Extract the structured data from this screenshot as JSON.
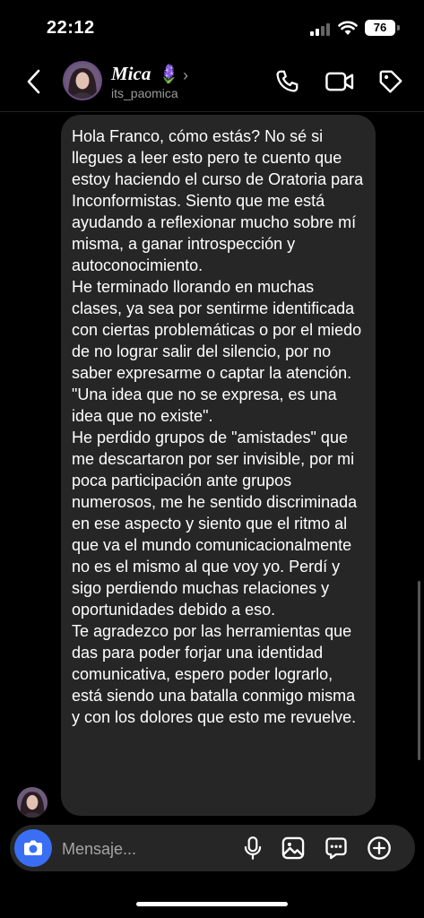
{
  "status_bar": {
    "time": "22:12",
    "battery": "76"
  },
  "header": {
    "contact_name": "Mica",
    "contact_emoji": "🪻",
    "username": "its_paomica"
  },
  "message": {
    "paragraphs": [
      "Hola Franco, cómo estás? No sé si llegues a leer esto pero te cuento que estoy haciendo el curso de Oratoria para Inconformistas. Siento que me está ayudando a reflexionar mucho sobre mí misma, a ganar introspección y autoconocimiento.",
      "He terminado llorando en muchas clases, ya sea por sentirme identificada con ciertas problemáticas o por el miedo de no lograr salir del silencio, por no saber expresarme o captar la atención. \"Una idea que no se expresa, es una idea que no existe\".",
      "He perdido grupos de \"amistades\" que me descartaron por ser invisible, por mi poca participación ante grupos numerosos, me he sentido discriminada en ese aspecto y siento que el ritmo al que va el mundo comunicacionalmente no es el mismo al que voy yo. Perdí y sigo perdiendo muchas relaciones y oportunidades debido a eso.",
      "Te agradezco por las herramientas que das para poder forjar una identidad comunicativa, espero poder lograrlo, está siendo una batalla conmigo misma y con los dolores que esto me revuelve."
    ]
  },
  "composer": {
    "placeholder": "Mensaje..."
  },
  "icons": {
    "back": "chevron-left-icon",
    "phone": "phone-icon",
    "video": "video-camera-icon",
    "tag": "tag-icon",
    "camera": "camera-icon",
    "mic": "microphone-icon",
    "gallery": "gallery-icon",
    "sticker": "sticker-chat-icon",
    "plus": "plus-circle-icon"
  },
  "colors": {
    "background": "#000000",
    "bubble": "#262626",
    "accent": "#3a6ff5",
    "secondary_text": "#9a9a9a"
  }
}
